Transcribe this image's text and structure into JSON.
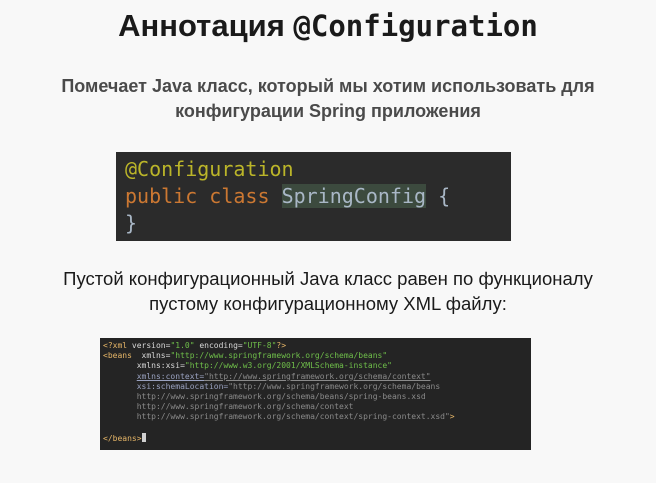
{
  "slide": {
    "title_prefix": "Аннотация ",
    "title_code": "@Configuration",
    "subtitle_line1": "Помечает Java класс, который мы хотим использовать для",
    "subtitle_line2": "конфигурации Spring приложения",
    "para_line1": "Пустой конфигурационный Java класс равен по функционалу",
    "para_line2": "пустому конфигурационному XML файлу:"
  },
  "java_code": {
    "annotation": "@Configuration",
    "kw_public": "public",
    "kw_class": "class",
    "class_name": "SpringConfig",
    "open_brace": "{",
    "close_brace": "}"
  },
  "xml_code": {
    "l1_start": "<?xml ",
    "l1_attr1": "version=",
    "l1_val1": "\"1.0\"",
    "l1_attr2": " encoding=",
    "l1_val2": "\"UTF-8\"",
    "l1_end": "?>",
    "l2_tag": "<beans",
    "l2_attr": "  xmlns=",
    "l2_val": "\"http://www.springframework.org/schema/beans\"",
    "l3_attr": "xmlns:xsi=",
    "l3_val": "\"http://www.w3.org/2001/XMLSchema-instance\"",
    "l4_attr": "xmlns:context=",
    "l4_val": "\"http://www.springframework.org/schema/context\"",
    "l5_attr": "xsi:schemaLocation=",
    "l5_val": "\"http://www.springframework.org/schema/beans",
    "l6_val": "http://www.springframework.org/schema/beans/spring-beans.xsd",
    "l7_val": "http://www.springframework.org/schema/context",
    "l8_val": "http://www.springframework.org/schema/context/spring-context.xsd\"",
    "l8_end": ">",
    "l10_tag": "</beans>"
  }
}
